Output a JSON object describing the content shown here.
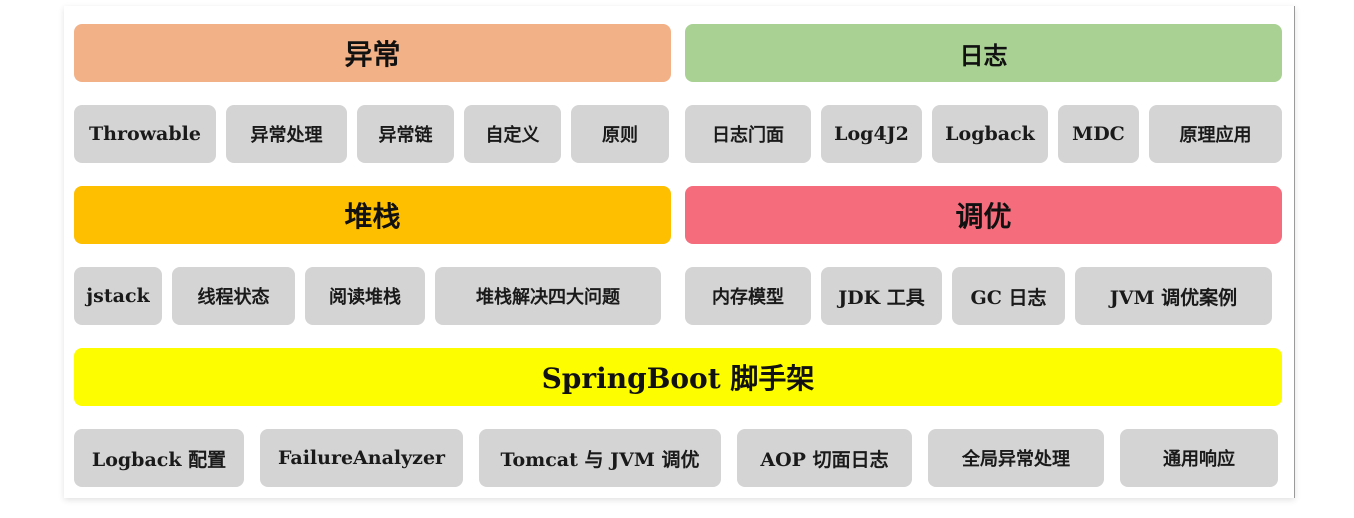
{
  "colors": {
    "exception": "#f3b187",
    "log": "#a8d193",
    "stack": "#fdbf00",
    "tuning": "#f56d7c",
    "springboot": "#fdfd00",
    "chip": "#d4d4d4"
  },
  "sections": {
    "exception": {
      "title": "异常",
      "items": [
        "Throwable",
        "异常处理",
        "异常链",
        "自定义",
        "原则"
      ]
    },
    "log": {
      "title": "日志",
      "items": [
        "日志门面",
        "Log4J2",
        "Logback",
        "MDC",
        "原理应用"
      ]
    },
    "stack": {
      "title": "堆栈",
      "items": [
        "jstack",
        "线程状态",
        "阅读堆栈",
        "堆栈解决四大问题"
      ]
    },
    "tuning": {
      "title": "调优",
      "items": [
        "内存模型",
        "JDK 工具",
        "GC 日志",
        "JVM 调优案例"
      ]
    },
    "springboot": {
      "title": "SpringBoot 脚手架",
      "items": [
        "Logback 配置",
        "FailureAnalyzer",
        "Tomcat 与 JVM 调优",
        "AOP 切面日志",
        "全局异常处理",
        "通用响应"
      ]
    }
  }
}
